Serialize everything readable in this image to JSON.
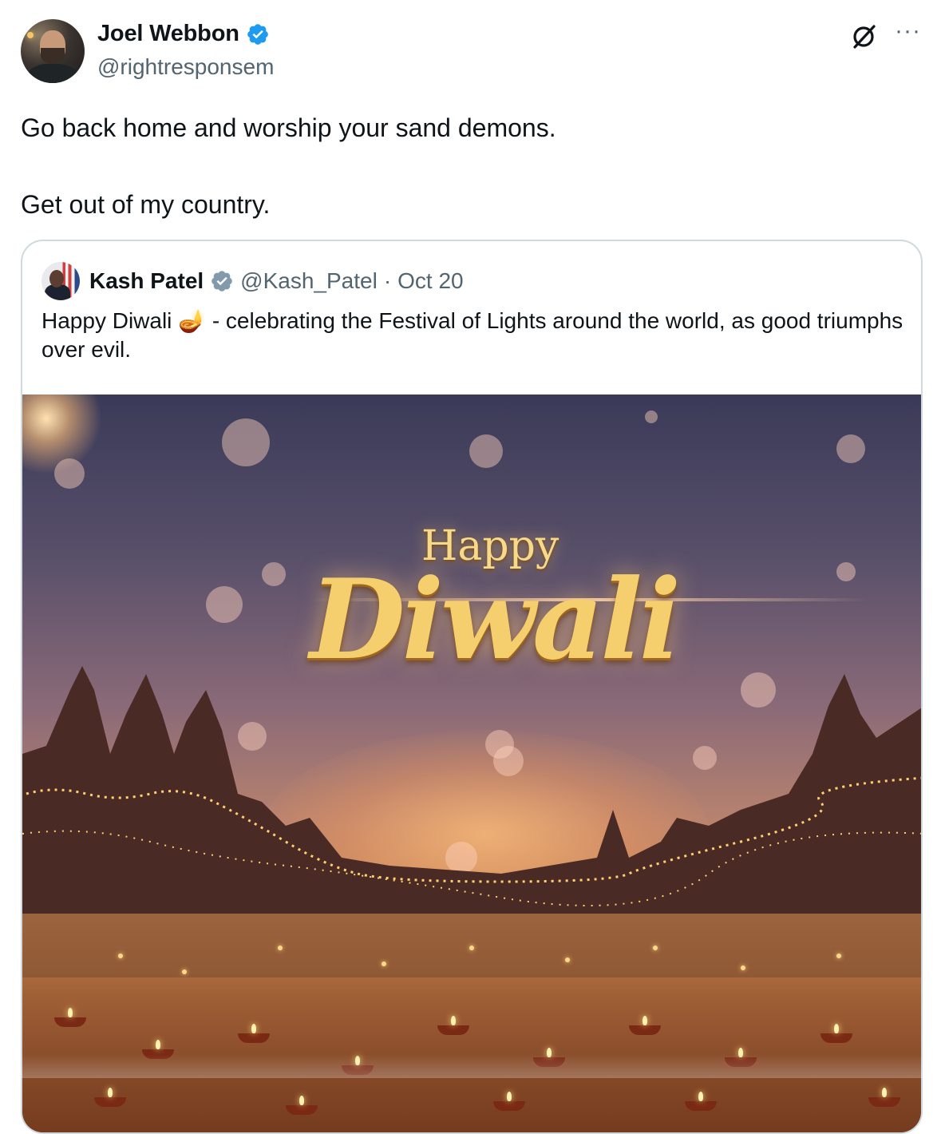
{
  "tweet": {
    "author": {
      "display_name": "Joel Webbon",
      "handle": "@rightresponsem",
      "verified": true
    },
    "text": "Go back home and worship your sand demons.\n\nGet out of my country.",
    "actions": {
      "grok_icon": "grok-icon",
      "more_icon": "more-icon",
      "more_label": "···"
    }
  },
  "quoted_tweet": {
    "author": {
      "display_name": "Kash Patel",
      "handle": "@Kash_Patel",
      "verified": true
    },
    "separator": "·",
    "date": "Oct 20",
    "text": "Happy Diwali 🪔 - celebrating the Festival of Lights around the world, as good triumphs over evil.",
    "media": {
      "line1": "Happy",
      "line2": "Diwali"
    }
  },
  "colors": {
    "text": "#0f1419",
    "secondary": "#536471",
    "verified_blue": "#1d9bf0",
    "border": "#cfd9de",
    "gold": "#f5cf6e"
  }
}
